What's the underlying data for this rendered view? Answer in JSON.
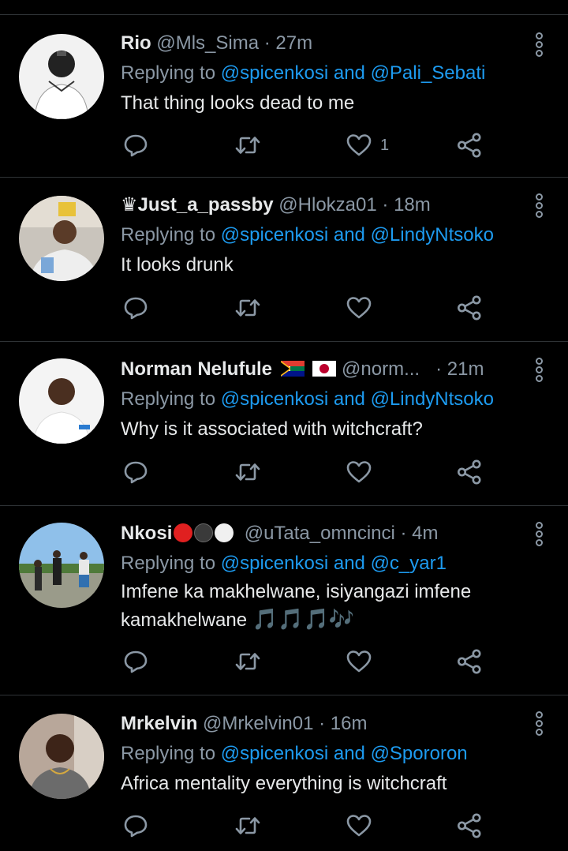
{
  "tweets": [
    {
      "name": "Rio",
      "handle": "@Mls_Sima",
      "time": "27m",
      "reply_prefix": "Replying to ",
      "mention1": "@spicenkosi",
      "and": " and ",
      "mention2": "@Pali_Sebati",
      "text": "That thing looks dead to me",
      "like_count": "1"
    },
    {
      "name": "♛Just_a_passby",
      "handle": "@Hlokza01",
      "time": "18m",
      "reply_prefix": "Replying to ",
      "mention1": "@spicenkosi",
      "and": " and ",
      "mention2": "@LindyNtsoko",
      "text": "It looks drunk",
      "like_count": ""
    },
    {
      "name": "Norman Nelufule",
      "handle": "@norm...",
      "time": "21m",
      "reply_prefix": "Replying to ",
      "mention1": "@spicenkosi",
      "and": " and ",
      "mention2": "@LindyNtsoko",
      "text": "Why is it associated with witchcraft?",
      "like_count": ""
    },
    {
      "name": "Nkosi",
      "handle": "@uTata_omncinci",
      "time": "4m",
      "reply_prefix": "Replying to ",
      "mention1": "@spicenkosi",
      "and": " and ",
      "mention2": "@c_yar1",
      "text": "Imfene ka makhelwane, isiyangazi imfene kamakhelwane",
      "notes": "🎵🎵🎵🎶",
      "like_count": ""
    },
    {
      "name": "Mrkelvin",
      "handle": "@Mrkelvin01",
      "time": "16m",
      "reply_prefix": "Replying to ",
      "mention1": "@spicenkosi",
      "and": " and ",
      "mention2": "@Spororon",
      "text": "Africa mentality everything is witchcraft",
      "like_count": ""
    }
  ],
  "separator": "·",
  "icons": [
    "reply-icon",
    "retweet-icon",
    "like-icon",
    "share-icon",
    "more-options-icon"
  ],
  "colors": {
    "background": "#000000",
    "text": "#e7e9ea",
    "secondary": "#8b98a5",
    "mention": "#1d9bf0",
    "divider": "#2f3336"
  }
}
